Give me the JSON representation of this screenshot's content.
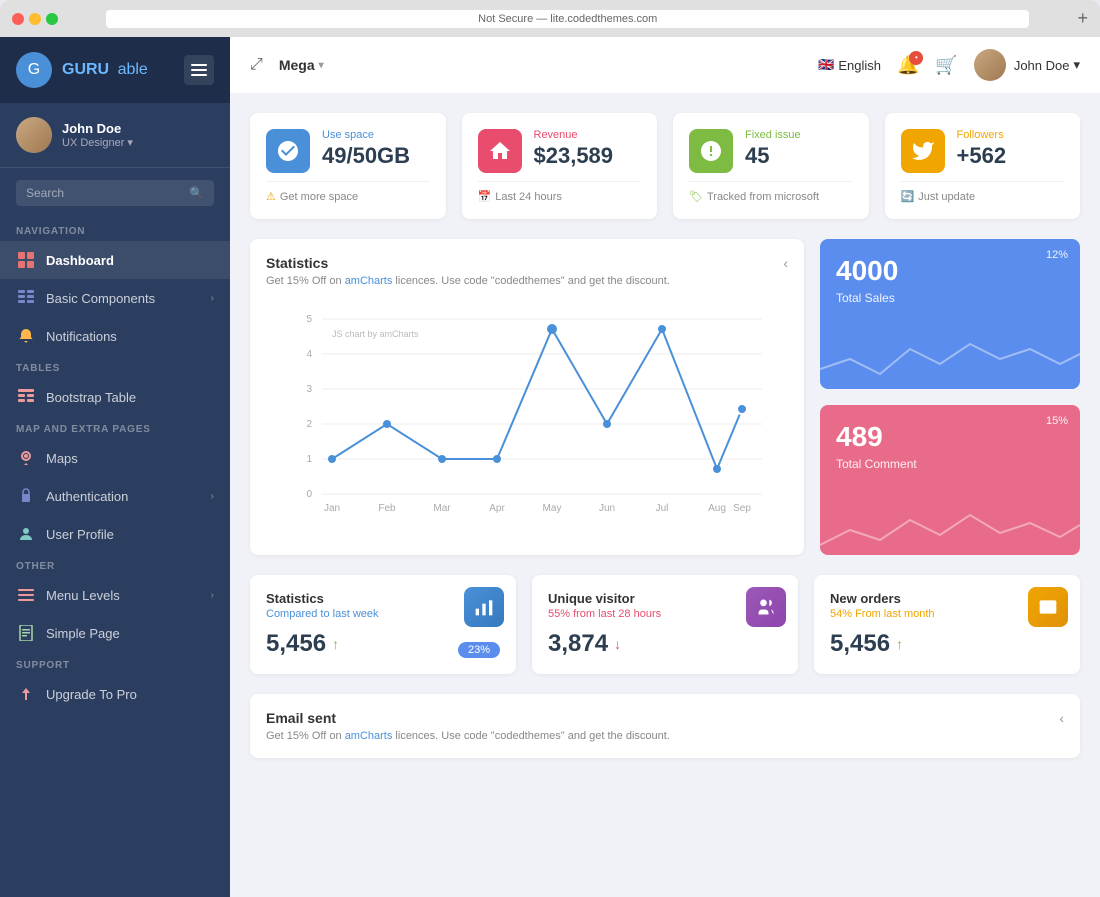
{
  "browser": {
    "url": "Not Secure — lite.codedthemes.com",
    "new_tab": "+"
  },
  "sidebar": {
    "logo_text": "GURU",
    "logo_accent": "able",
    "user_name": "John Doe",
    "user_role": "UX Designer",
    "search_placeholder": "Search",
    "nav_label_1": "Navigation",
    "nav_items_1": [
      {
        "label": "Dashboard",
        "icon": "🏠",
        "active": true
      },
      {
        "label": "Basic Components",
        "icon": "🔲",
        "chevron": true
      },
      {
        "label": "Notifications",
        "icon": "🔔"
      }
    ],
    "nav_label_2": "Tables",
    "nav_items_2": [
      {
        "label": "Bootstrap Table",
        "icon": "📋"
      }
    ],
    "nav_label_3": "Map And Extra Pages",
    "nav_items_3": [
      {
        "label": "Maps",
        "icon": "🗺"
      },
      {
        "label": "Authentication",
        "icon": "🔒",
        "chevron": true
      },
      {
        "label": "User Profile",
        "icon": "👤"
      }
    ],
    "nav_label_4": "Other",
    "nav_items_4": [
      {
        "label": "Menu Levels",
        "icon": "☰",
        "chevron": true
      },
      {
        "label": "Simple Page",
        "icon": "📄"
      }
    ],
    "nav_label_5": "Support",
    "nav_items_5": [
      {
        "label": "Upgrade To Pro",
        "icon": "⬆"
      }
    ]
  },
  "header": {
    "menu_name": "Mega",
    "language": "English",
    "user_name": "John Doe"
  },
  "stats": [
    {
      "label": "Use space",
      "value": "49/50GB",
      "footer": "Get more space",
      "icon_class": "stat-icon-blue",
      "label_class": "stat-label-blue",
      "footer_icon": "⚠"
    },
    {
      "label": "Revenue",
      "value": "$23,589",
      "footer": "Last 24 hours",
      "icon_class": "stat-icon-pink",
      "label_class": "stat-label-pink",
      "footer_icon": "📅"
    },
    {
      "label": "Fixed issue",
      "value": "45",
      "footer": "Tracked from microsoft",
      "icon_class": "stat-icon-green",
      "label_class": "stat-label-green",
      "footer_icon": "🏷"
    },
    {
      "label": "Followers",
      "value": "+562",
      "footer": "Just update",
      "icon_class": "stat-icon-orange",
      "label_class": "stat-label-orange",
      "footer_icon": "🔄"
    }
  ],
  "chart": {
    "title": "Statistics",
    "subtitle_text": "Get 15% Off on ",
    "subtitle_link": "amCharts",
    "subtitle_after": " licences. Use code \"codedthemes\" and get the discount.",
    "y_label": "JS chart by amCharts",
    "months": [
      "Jan",
      "Feb",
      "Mar",
      "Apr",
      "May",
      "Jun",
      "Jul",
      "Aug",
      "Sep"
    ],
    "y_values": [
      0,
      1,
      2,
      3,
      4,
      5
    ]
  },
  "metrics": [
    {
      "value": "4000",
      "label": "Total Sales",
      "percent": "12%",
      "card_class": "metric-card-blue"
    },
    {
      "value": "489",
      "label": "Total Comment",
      "percent": "15%",
      "card_class": "metric-card-pink"
    }
  ],
  "bottom_stats": [
    {
      "title": "Statistics",
      "subtitle": "Compared to last week",
      "subtitle_class": "bc-subtitle-blue",
      "value": "5,456",
      "arrow": "up",
      "badge": "23%",
      "icon_class": "icon-blue-grad",
      "icon": "💻"
    },
    {
      "title": "Unique visitor",
      "subtitle": "55% from last 28 hours",
      "subtitle_class": "bc-subtitle-pink",
      "value": "3,874",
      "arrow": "down",
      "icon_class": "icon-purple-grad",
      "icon": "👥"
    },
    {
      "title": "New orders",
      "subtitle": "54% From last month",
      "subtitle_class": "bc-subtitle-orange",
      "value": "5,456",
      "arrow": "up",
      "icon_class": "icon-orange-grad",
      "icon": "📊"
    }
  ],
  "email_card": {
    "title": "Email sent",
    "subtitle_text": "Get 15% Off on ",
    "subtitle_link": "amCharts",
    "subtitle_after": " licences. Use code \"codedthemes\" and get the discount."
  }
}
